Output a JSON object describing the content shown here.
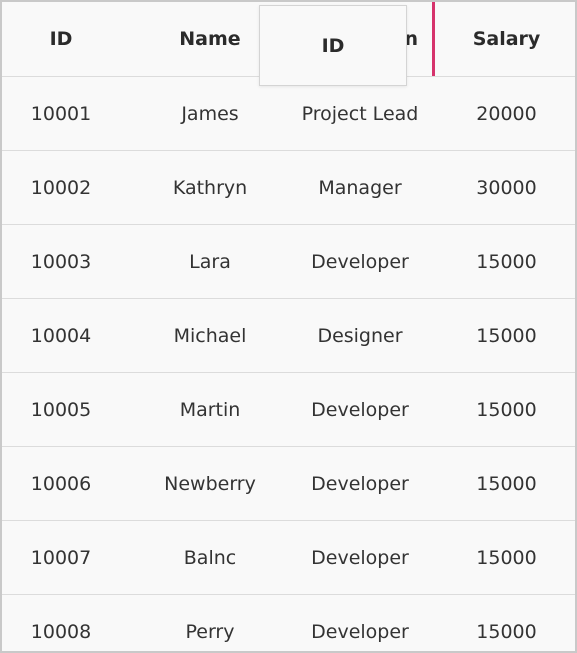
{
  "columns": [
    "ID",
    "Name",
    "Designation",
    "Salary"
  ],
  "header_visible": {
    "designation_tail": "n"
  },
  "drag": {
    "label": "ID",
    "indicator_color": "#d6336c"
  },
  "rows": [
    [
      "10001",
      "James",
      "Project Lead",
      "20000"
    ],
    [
      "10002",
      "Kathryn",
      "Manager",
      "30000"
    ],
    [
      "10003",
      "Lara",
      "Developer",
      "15000"
    ],
    [
      "10004",
      "Michael",
      "Designer",
      "15000"
    ],
    [
      "10005",
      "Martin",
      "Developer",
      "15000"
    ],
    [
      "10006",
      "Newberry",
      "Developer",
      "15000"
    ],
    [
      "10007",
      "Balnc",
      "Developer",
      "15000"
    ],
    [
      "10008",
      "Perry",
      "Developer",
      "15000"
    ]
  ]
}
